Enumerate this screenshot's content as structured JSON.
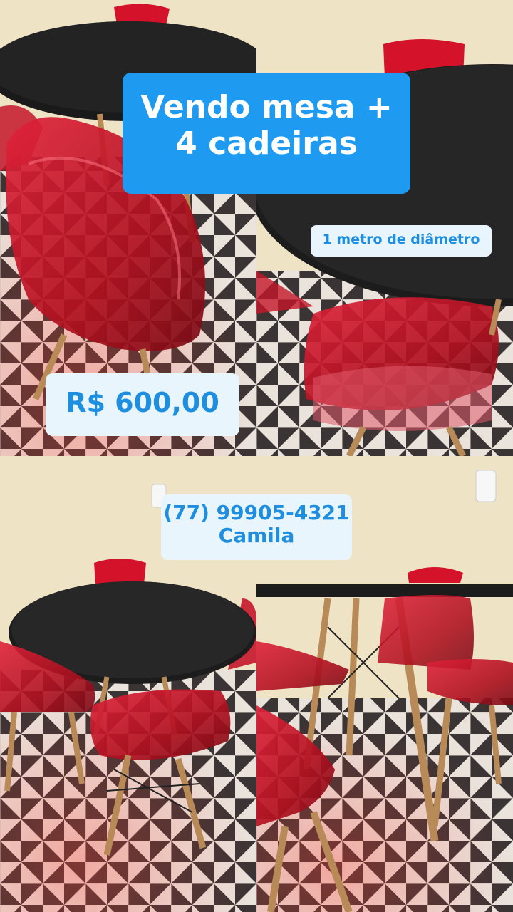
{
  "sticker": {
    "title_line1": "Vendo mesa +",
    "title_line2": "4 cadeiras",
    "diameter": "1 metro de diâmetro",
    "price": "R$ 600,00",
    "phone": "(77) 99905-4321",
    "name": "Camila"
  },
  "colors": {
    "sticker_blue": "#1e9bf0",
    "sticker_light": "#e9f5fd",
    "chair_red": "#c8102e",
    "table_black": "#1a1a1a",
    "wall": "#efe3c6"
  }
}
